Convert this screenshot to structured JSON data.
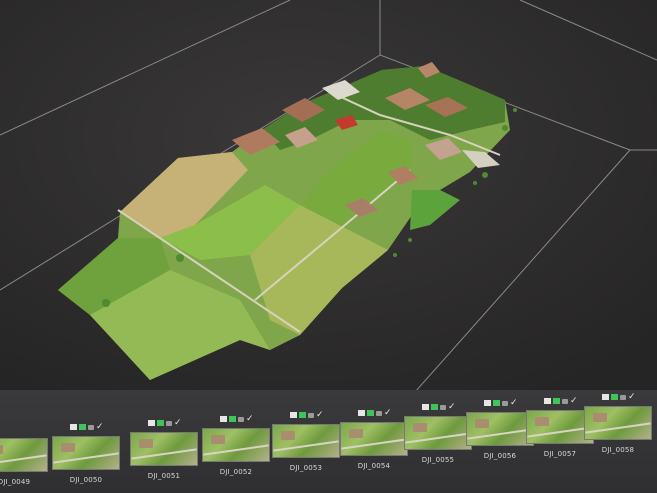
{
  "viewport": {
    "grid_color": "#8a8a8a",
    "background": "#2e2c2c"
  },
  "filmstrip": {
    "photos": [
      {
        "label": "DJI_0049"
      },
      {
        "label": "DJI_0050"
      },
      {
        "label": "DJI_0051"
      },
      {
        "label": "DJI_0052"
      },
      {
        "label": "DJI_0053"
      },
      {
        "label": "DJI_0054"
      },
      {
        "label": "DJI_0055"
      },
      {
        "label": "DJI_0056"
      },
      {
        "label": "DJI_0057"
      },
      {
        "label": "DJI_0058"
      }
    ],
    "check_glyph": "✓",
    "status_colors": {
      "flag_white": "#e6e6e6",
      "flag_green": "#3fc45a",
      "flag_grey": "#9a9a9a"
    }
  }
}
